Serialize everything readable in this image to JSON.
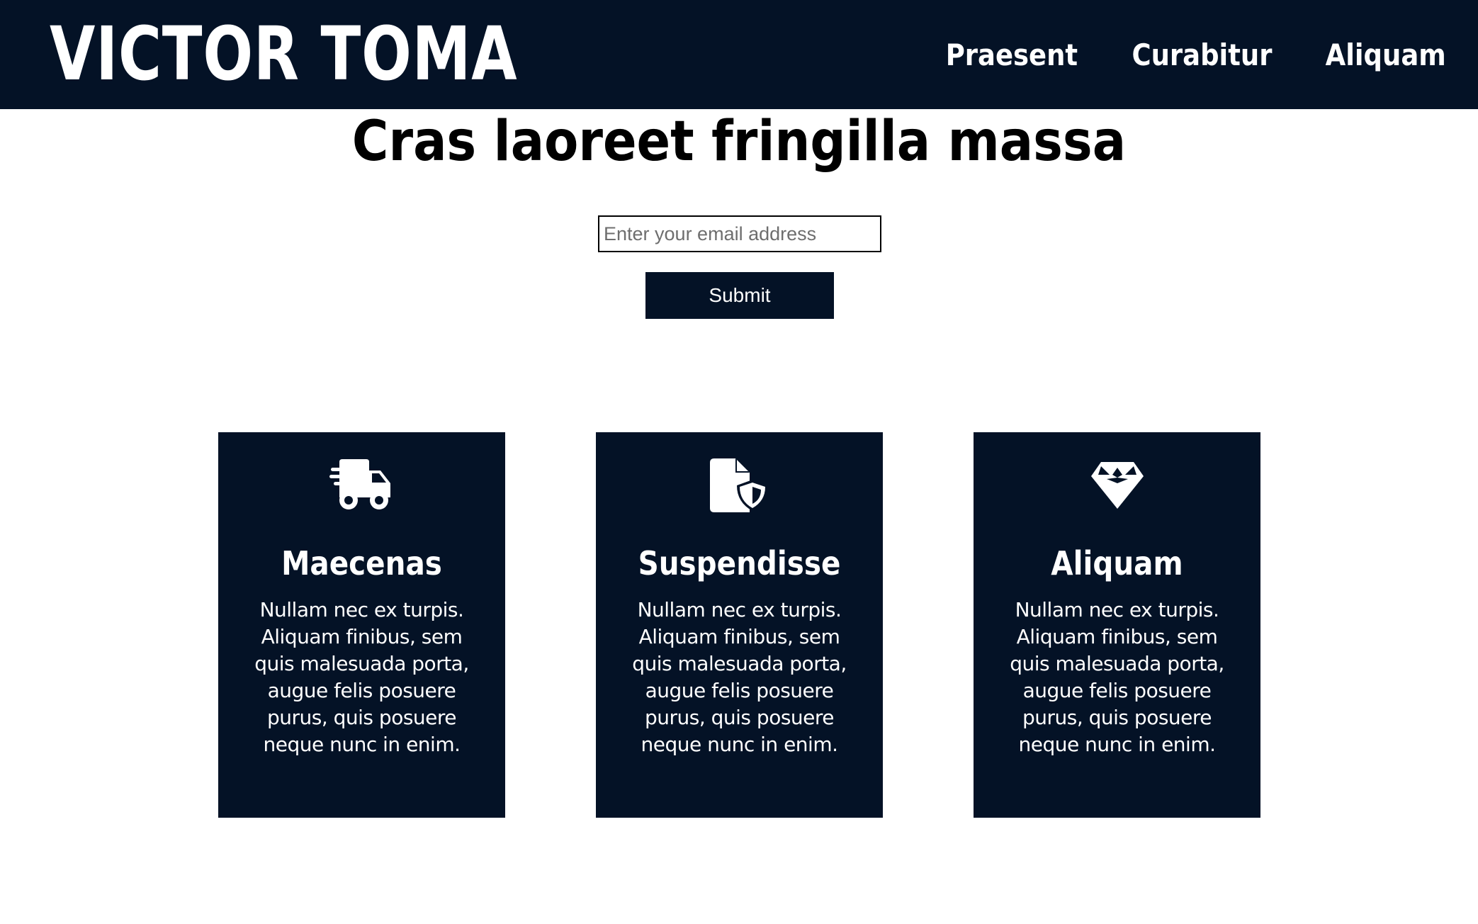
{
  "header": {
    "brand": "VICTOR TOMA",
    "nav": [
      {
        "label": "Praesent"
      },
      {
        "label": "Curabitur"
      },
      {
        "label": "Aliquam"
      }
    ]
  },
  "main": {
    "title": "Cras laoreet fringilla massa",
    "email_placeholder": "Enter your email address",
    "submit_label": "Submit"
  },
  "cards": [
    {
      "icon": "delivery-truck-icon",
      "title": "Maecenas",
      "text": "Nullam nec ex turpis. Aliquam finibus, sem quis malesuada porta, augue felis posuere purus, quis posuere neque nunc in enim."
    },
    {
      "icon": "file-shield-icon",
      "title": "Suspendisse",
      "text": "Nullam nec ex turpis. Aliquam finibus, sem quis malesuada porta, augue felis posuere purus, quis posuere neque nunc in enim."
    },
    {
      "icon": "gem-icon",
      "title": "Aliquam",
      "text": "Nullam nec ex turpis. Aliquam finibus, sem quis malesuada porta, augue felis posuere purus, quis posuere neque nunc in enim."
    }
  ],
  "colors": {
    "dark_navy": "#041226",
    "white": "#ffffff",
    "text": "#000000"
  }
}
